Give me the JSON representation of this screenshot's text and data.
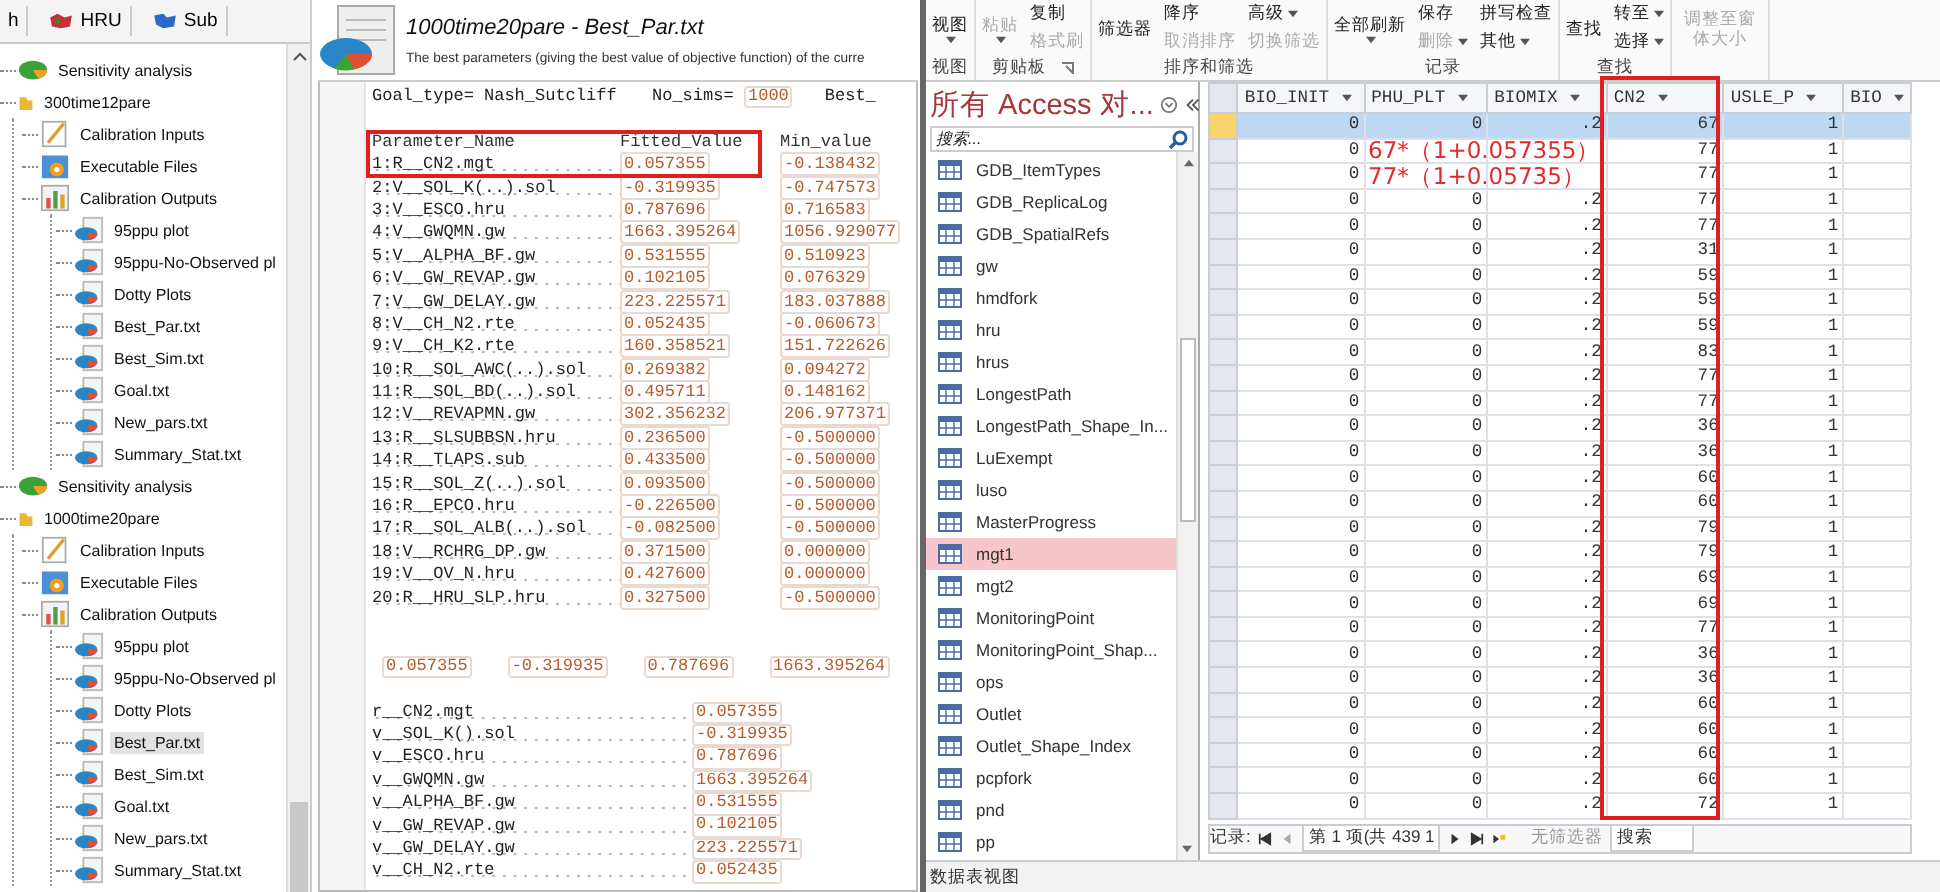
{
  "tree_tabs": [
    {
      "label": "h",
      "kind": "plain"
    },
    {
      "label": "HRU",
      "kind": "hru"
    },
    {
      "label": "Sub",
      "kind": "sub"
    }
  ],
  "tree": [
    {
      "label": "Sensitivity analysis",
      "kind": "analysis",
      "selected": false
    },
    {
      "label": "300time12pare",
      "kind": "folder",
      "selected": false,
      "children": [
        {
          "label": "Calibration Inputs",
          "kind": "inputs",
          "selected": false
        },
        {
          "label": "Executable Files",
          "kind": "exe",
          "selected": false
        },
        {
          "label": "Calibration Outputs",
          "kind": "outputs",
          "selected": false,
          "children": [
            {
              "label": "95ppu plot",
              "kind": "file",
              "selected": false
            },
            {
              "label": "95ppu-No-Observed pl",
              "kind": "file",
              "selected": false
            },
            {
              "label": "Dotty Plots",
              "kind": "file",
              "selected": false
            },
            {
              "label": "Best_Par.txt",
              "kind": "file",
              "selected": false
            },
            {
              "label": "Best_Sim.txt",
              "kind": "file",
              "selected": false
            },
            {
              "label": "Goal.txt",
              "kind": "file",
              "selected": false
            },
            {
              "label": "New_pars.txt",
              "kind": "file",
              "selected": false
            },
            {
              "label": "Summary_Stat.txt",
              "kind": "file",
              "selected": false
            }
          ]
        }
      ]
    },
    {
      "label": "Sensitivity analysis",
      "kind": "analysis",
      "selected": false
    },
    {
      "label": "1000time20pare",
      "kind": "folder",
      "selected": false,
      "children": [
        {
          "label": "Calibration Inputs",
          "kind": "inputs",
          "selected": false
        },
        {
          "label": "Executable Files",
          "kind": "exe",
          "selected": false
        },
        {
          "label": "Calibration Outputs",
          "kind": "outputs",
          "selected": false,
          "children": [
            {
              "label": "95ppu plot",
              "kind": "file",
              "selected": false
            },
            {
              "label": "95ppu-No-Observed pl",
              "kind": "file",
              "selected": false
            },
            {
              "label": "Dotty Plots",
              "kind": "file",
              "selected": false
            },
            {
              "label": "Best_Par.txt",
              "kind": "file",
              "selected": true
            },
            {
              "label": "Best_Sim.txt",
              "kind": "file",
              "selected": false
            },
            {
              "label": "Goal.txt",
              "kind": "file",
              "selected": false
            },
            {
              "label": "New_pars.txt",
              "kind": "file",
              "selected": false
            },
            {
              "label": "Summary_Stat.txt",
              "kind": "file",
              "selected": false
            }
          ]
        }
      ]
    }
  ],
  "document": {
    "title": "1000time20pare - Best_Par.txt",
    "description": "The best parameters (giving the best value of objective function) of the curre",
    "goal_line": [
      "Goal_type=",
      "Nash_Sutcliff",
      "No_sims=",
      "1000",
      "Best_"
    ],
    "columns": [
      "Parameter_Name",
      "Fitted_Value",
      "Min_value"
    ],
    "rows": [
      {
        "name": "1:R__CN2.mgt",
        "fitted": "0.057355",
        "min": "-0.138432"
      },
      {
        "name": "2:V__SOL_K(..).sol",
        "fitted": "-0.319935",
        "min": "-0.747573"
      },
      {
        "name": "3:V__ESCO.hru",
        "fitted": "0.787696",
        "min": "0.716583"
      },
      {
        "name": "4:V__GWQMN.gw",
        "fitted": "1663.395264",
        "min": "1056.929077"
      },
      {
        "name": "5:V__ALPHA_BF.gw",
        "fitted": "0.531555",
        "min": "0.510923"
      },
      {
        "name": "6:V__GW_REVAP.gw",
        "fitted": "0.102105",
        "min": "0.076329"
      },
      {
        "name": "7:V__GW_DELAY.gw",
        "fitted": "223.225571",
        "min": "183.037888"
      },
      {
        "name": "8:V__CH_N2.rte",
        "fitted": "0.052435",
        "min": "-0.060673"
      },
      {
        "name": "9:V__CH_K2.rte",
        "fitted": "160.358521",
        "min": "151.722626"
      },
      {
        "name": "10:R__SOL_AWC(..).sol",
        "fitted": "0.269382",
        "min": "0.094272"
      },
      {
        "name": "11:R__SOL_BD(..).sol",
        "fitted": "0.495711",
        "min": "0.148162"
      },
      {
        "name": "12:V__REVAPMN.gw",
        "fitted": "302.356232",
        "min": "206.977371"
      },
      {
        "name": "13:R__SLSUBBSN.hru",
        "fitted": "0.236500",
        "min": "-0.500000"
      },
      {
        "name": "14:R__TLAPS.sub",
        "fitted": "0.433500",
        "min": "-0.500000"
      },
      {
        "name": "15:R__SOL_Z(..).sol",
        "fitted": "0.093500",
        "min": "-0.500000"
      },
      {
        "name": "16:R__EPCO.hru",
        "fitted": "-0.226500",
        "min": "-0.500000"
      },
      {
        "name": "17:R__SOL_ALB(..).sol",
        "fitted": "-0.082500",
        "min": "-0.500000"
      },
      {
        "name": "18:V__RCHRG_DP.gw",
        "fitted": "0.371500",
        "min": "0.000000"
      },
      {
        "name": "19:V__OV_N.hru",
        "fitted": "0.427600",
        "min": "0.000000"
      },
      {
        "name": "20:R__HRU_SLP.hru",
        "fitted": "0.327500",
        "min": "-0.500000"
      }
    ],
    "values_line": [
      "0.057355",
      "-0.319935",
      "0.787696",
      "1663.395264"
    ],
    "summary": [
      {
        "name": "r__CN2.mgt",
        "value": "0.057355"
      },
      {
        "name": "v__SOL_K().sol",
        "value": "-0.319935"
      },
      {
        "name": "v__ESCO.hru",
        "value": "0.787696"
      },
      {
        "name": "v__GWQMN.gw",
        "value": "1663.395264"
      },
      {
        "name": "v__ALPHA_BF.gw",
        "value": "0.531555"
      },
      {
        "name": "v__GW_REVAP.gw",
        "value": "0.102105"
      },
      {
        "name": "v__GW_DELAY.gw",
        "value": "223.225571"
      },
      {
        "name": "v__CH_N2.rte",
        "value": "0.052435"
      }
    ]
  },
  "ribbon": [
    {
      "label": "视图",
      "buttons": [
        {
          "label": "视图",
          "kind": "large",
          "disabled": false,
          "caret": true
        }
      ]
    },
    {
      "label": "剪贴板",
      "launcher": true,
      "buttons": [
        {
          "label": "粘贴",
          "kind": "large",
          "disabled": true,
          "caret": true
        },
        {
          "label": "复制",
          "kind": "small",
          "disabled": false,
          "caret": false
        },
        {
          "label": "格式刷",
          "kind": "small",
          "disabled": true,
          "caret": false
        }
      ]
    },
    {
      "label": "排序和筛选",
      "buttons": [
        {
          "label": "筛选器",
          "kind": "large",
          "disabled": false,
          "caret": false
        },
        {
          "label": "降序",
          "kind": "small",
          "disabled": false,
          "caret": false
        },
        {
          "label": "取消排序",
          "kind": "small",
          "disabled": true,
          "caret": false
        },
        {
          "label": "高级",
          "kind": "small",
          "disabled": false,
          "caret": true
        },
        {
          "label": "切换筛选",
          "kind": "small",
          "disabled": true,
          "caret": false
        }
      ]
    },
    {
      "label": "记录",
      "buttons": [
        {
          "label": "全部刷新",
          "kind": "large",
          "disabled": false,
          "caret": true
        },
        {
          "label": "保存",
          "kind": "small",
          "disabled": false,
          "caret": false
        },
        {
          "label": "删除",
          "kind": "small",
          "disabled": true,
          "caret": true
        },
        {
          "label": "拼写检查",
          "kind": "small",
          "disabled": false,
          "caret": false
        },
        {
          "label": "其他",
          "kind": "small",
          "disabled": false,
          "caret": true
        }
      ]
    },
    {
      "label": "查找",
      "buttons": [
        {
          "label": "查找",
          "kind": "large",
          "disabled": false,
          "caret": false
        },
        {
          "label": "转至",
          "kind": "small",
          "disabled": false,
          "caret": true
        },
        {
          "label": "选择",
          "kind": "small",
          "disabled": false,
          "caret": true
        }
      ]
    },
    {
      "buttons": [
        {
          "label": "调整至窗体大小",
          "kind": "large",
          "disabled": true,
          "caret": false
        }
      ]
    }
  ],
  "navigation": {
    "title": "所有 Access 对...",
    "search": {
      "placeholder": "搜索..."
    },
    "items": [
      {
        "label": "GDB_ItemTypes",
        "selected": false
      },
      {
        "label": "GDB_ReplicaLog",
        "selected": false
      },
      {
        "label": "GDB_SpatialRefs",
        "selected": false
      },
      {
        "label": "gw",
        "selected": false
      },
      {
        "label": "hmdfork",
        "selected": false
      },
      {
        "label": "hru",
        "selected": false
      },
      {
        "label": "hrus",
        "selected": false
      },
      {
        "label": "LongestPath",
        "selected": false
      },
      {
        "label": "LongestPath_Shape_In...",
        "selected": false
      },
      {
        "label": "LuExempt",
        "selected": false
      },
      {
        "label": "luso",
        "selected": false
      },
      {
        "label": "MasterProgress",
        "selected": false
      },
      {
        "label": "mgt1",
        "selected": true
      },
      {
        "label": "mgt2",
        "selected": false
      },
      {
        "label": "MonitoringPoint",
        "selected": false
      },
      {
        "label": "MonitoringPoint_Shap...",
        "selected": false
      },
      {
        "label": "ops",
        "selected": false
      },
      {
        "label": "Outlet",
        "selected": false
      },
      {
        "label": "Outlet_Shape_Index",
        "selected": false
      },
      {
        "label": "pcpfork",
        "selected": false
      },
      {
        "label": "pnd",
        "selected": false
      },
      {
        "label": "pp",
        "selected": false
      }
    ]
  },
  "table": {
    "columns": [
      "BIO_INIT",
      "PHU_PLT",
      "BIOMIX",
      "CN2",
      "USLE_P",
      "BIO"
    ],
    "rows": [
      {
        "cells": [
          "0",
          "0",
          ".2",
          "67",
          "1"
        ],
        "selected": true
      },
      {
        "cells": [
          "0",
          null,
          null,
          "77",
          "1"
        ],
        "selected": false
      },
      {
        "cells": [
          "0",
          null,
          null,
          "77",
          "1"
        ],
        "selected": false
      },
      {
        "cells": [
          "0",
          "0",
          ".2",
          "77",
          "1"
        ],
        "selected": false
      },
      {
        "cells": [
          "0",
          "0",
          ".2",
          "77",
          "1"
        ],
        "selected": false
      },
      {
        "cells": [
          "0",
          "0",
          ".2",
          "31",
          "1"
        ],
        "selected": false
      },
      {
        "cells": [
          "0",
          "0",
          ".2",
          "59",
          "1"
        ],
        "selected": false
      },
      {
        "cells": [
          "0",
          "0",
          ".2",
          "59",
          "1"
        ],
        "selected": false
      },
      {
        "cells": [
          "0",
          "0",
          ".2",
          "59",
          "1"
        ],
        "selected": false
      },
      {
        "cells": [
          "0",
          "0",
          ".2",
          "83",
          "1"
        ],
        "selected": false
      },
      {
        "cells": [
          "0",
          "0",
          ".2",
          "77",
          "1"
        ],
        "selected": false
      },
      {
        "cells": [
          "0",
          "0",
          ".2",
          "77",
          "1"
        ],
        "selected": false
      },
      {
        "cells": [
          "0",
          "0",
          ".2",
          "36",
          "1"
        ],
        "selected": false
      },
      {
        "cells": [
          "0",
          "0",
          ".2",
          "36",
          "1"
        ],
        "selected": false
      },
      {
        "cells": [
          "0",
          "0",
          ".2",
          "60",
          "1"
        ],
        "selected": false
      },
      {
        "cells": [
          "0",
          "0",
          ".2",
          "60",
          "1"
        ],
        "selected": false
      },
      {
        "cells": [
          "0",
          "0",
          ".2",
          "79",
          "1"
        ],
        "selected": false
      },
      {
        "cells": [
          "0",
          "0",
          ".2",
          "79",
          "1"
        ],
        "selected": false
      },
      {
        "cells": [
          "0",
          "0",
          ".2",
          "69",
          "1"
        ],
        "selected": false
      },
      {
        "cells": [
          "0",
          "0",
          ".2",
          "69",
          "1"
        ],
        "selected": false
      },
      {
        "cells": [
          "0",
          "0",
          ".2",
          "77",
          "1"
        ],
        "selected": false
      },
      {
        "cells": [
          "0",
          "0",
          ".2",
          "36",
          "1"
        ],
        "selected": false
      },
      {
        "cells": [
          "0",
          "0",
          ".2",
          "36",
          "1"
        ],
        "selected": false
      },
      {
        "cells": [
          "0",
          "0",
          ".2",
          "60",
          "1"
        ],
        "selected": false
      },
      {
        "cells": [
          "0",
          "0",
          ".2",
          "60",
          "1"
        ],
        "selected": false
      },
      {
        "cells": [
          "0",
          "0",
          ".2",
          "60",
          "1"
        ],
        "selected": false
      },
      {
        "cells": [
          "0",
          "0",
          ".2",
          "60",
          "1"
        ],
        "selected": false
      },
      {
        "cells": [
          "0",
          "0",
          ".2",
          "72",
          "1"
        ],
        "selected": false
      }
    ],
    "record_bar": {
      "label": "记录:",
      "position": "第 1 项(共 439 1",
      "filter": "无筛选器",
      "search": "搜索"
    }
  },
  "annotations": [
    "67*（1+0.057355）",
    "77*（1+0.05735）"
  ],
  "status_bar": "数据表视图"
}
